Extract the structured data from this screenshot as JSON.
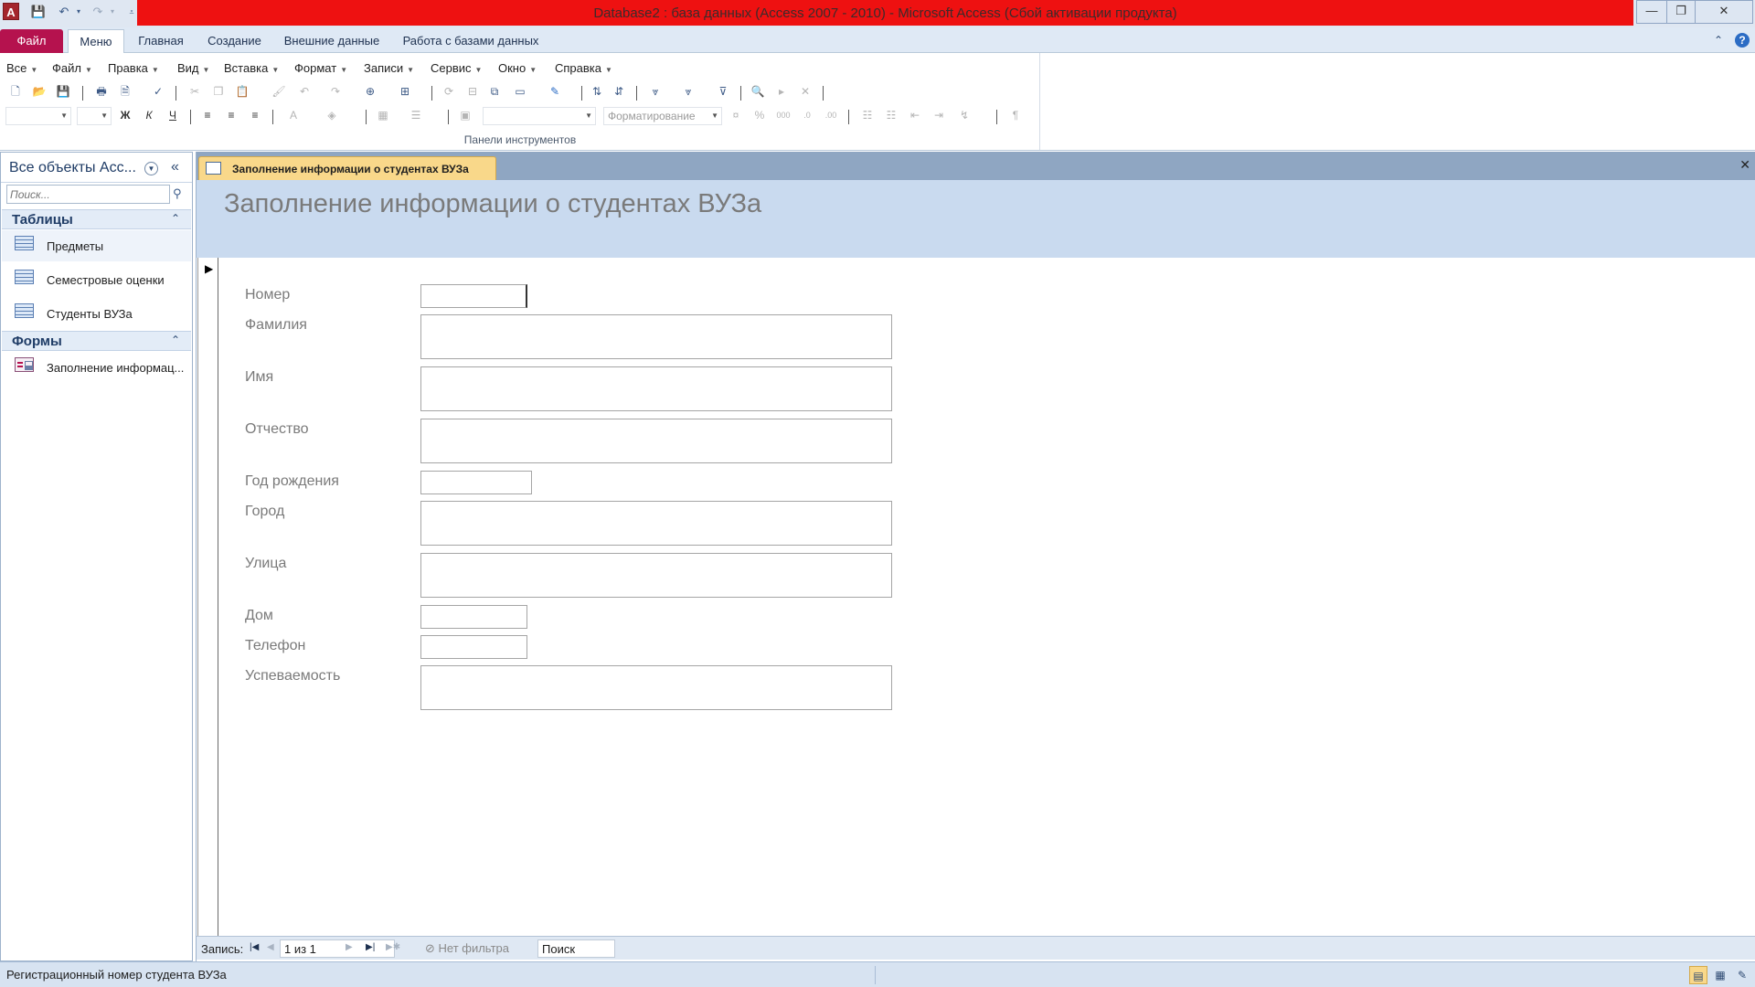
{
  "window": {
    "title": "Database2 : база данных (Access 2007 - 2010)  -  Microsoft Access (Сбой активации продукта)",
    "app_icon": "A",
    "quick_access": [
      "save-icon",
      "undo-icon",
      "redo-icon",
      "customize-icon"
    ],
    "controls": {
      "minimize": "—",
      "restore": "❐",
      "close": "✕"
    }
  },
  "ribbon_tabs": [
    {
      "label": "Файл"
    },
    {
      "label": "Меню"
    },
    {
      "label": "Главная"
    },
    {
      "label": "Создание"
    },
    {
      "label": "Внешние данные"
    },
    {
      "label": "Работа с базами данных"
    }
  ],
  "ribbon_right_icons": {
    "minimize_ribbon": "⌃",
    "help": "?"
  },
  "menu_bar": [
    {
      "label": "Все"
    },
    {
      "label": "Файл"
    },
    {
      "label": "Правка"
    },
    {
      "label": "Вид"
    },
    {
      "label": "Вставка"
    },
    {
      "label": "Формат"
    },
    {
      "label": "Записи"
    },
    {
      "label": "Сервис"
    },
    {
      "label": "Окно"
    },
    {
      "label": "Справка"
    }
  ],
  "toolbar": {
    "format_text": {
      "bold": "Ж",
      "italic": "К",
      "underline": "Ч"
    },
    "formatting_combo_placeholder": "Форматирование",
    "group_label": "Панели инструментов"
  },
  "nav_pane": {
    "title": "Все объекты Acc...",
    "search_placeholder": "Поиск...",
    "groups": [
      {
        "label": "Таблицы",
        "items": [
          {
            "label": "Предметы",
            "icon": "table-icon"
          },
          {
            "label": "Семестровые оценки",
            "icon": "table-icon"
          },
          {
            "label": "Студенты ВУЗа",
            "icon": "table-icon"
          }
        ]
      },
      {
        "label": "Формы",
        "items": [
          {
            "label": "Заполнение информац...",
            "icon": "form-icon"
          }
        ]
      }
    ]
  },
  "document": {
    "tab_label": "Заполнение информации о студентах ВУЗа",
    "form_title": "Заполнение информации о студентах ВУЗа",
    "fields": [
      {
        "label": "Номер",
        "value": ""
      },
      {
        "label": "Фамилия",
        "value": ""
      },
      {
        "label": "Имя",
        "value": ""
      },
      {
        "label": "Отчество",
        "value": ""
      },
      {
        "label": "Год рождения",
        "value": ""
      },
      {
        "label": "Город",
        "value": ""
      },
      {
        "label": "Улица",
        "value": ""
      },
      {
        "label": "Дом",
        "value": ""
      },
      {
        "label": "Телефон",
        "value": ""
      },
      {
        "label": "Успеваемость",
        "value": ""
      }
    ]
  },
  "record_nav": {
    "label": "Запись:",
    "position": "1 из 1",
    "filter": "Нет фильтра",
    "search": "Поиск"
  },
  "status_bar": {
    "text": "Регистрационный номер студента ВУЗа"
  },
  "colors": {
    "title_bar_red": "#ee1111",
    "file_tab": "#b5124e",
    "form_header": "#c9daef",
    "doc_tab_active": "#f9d88a"
  }
}
